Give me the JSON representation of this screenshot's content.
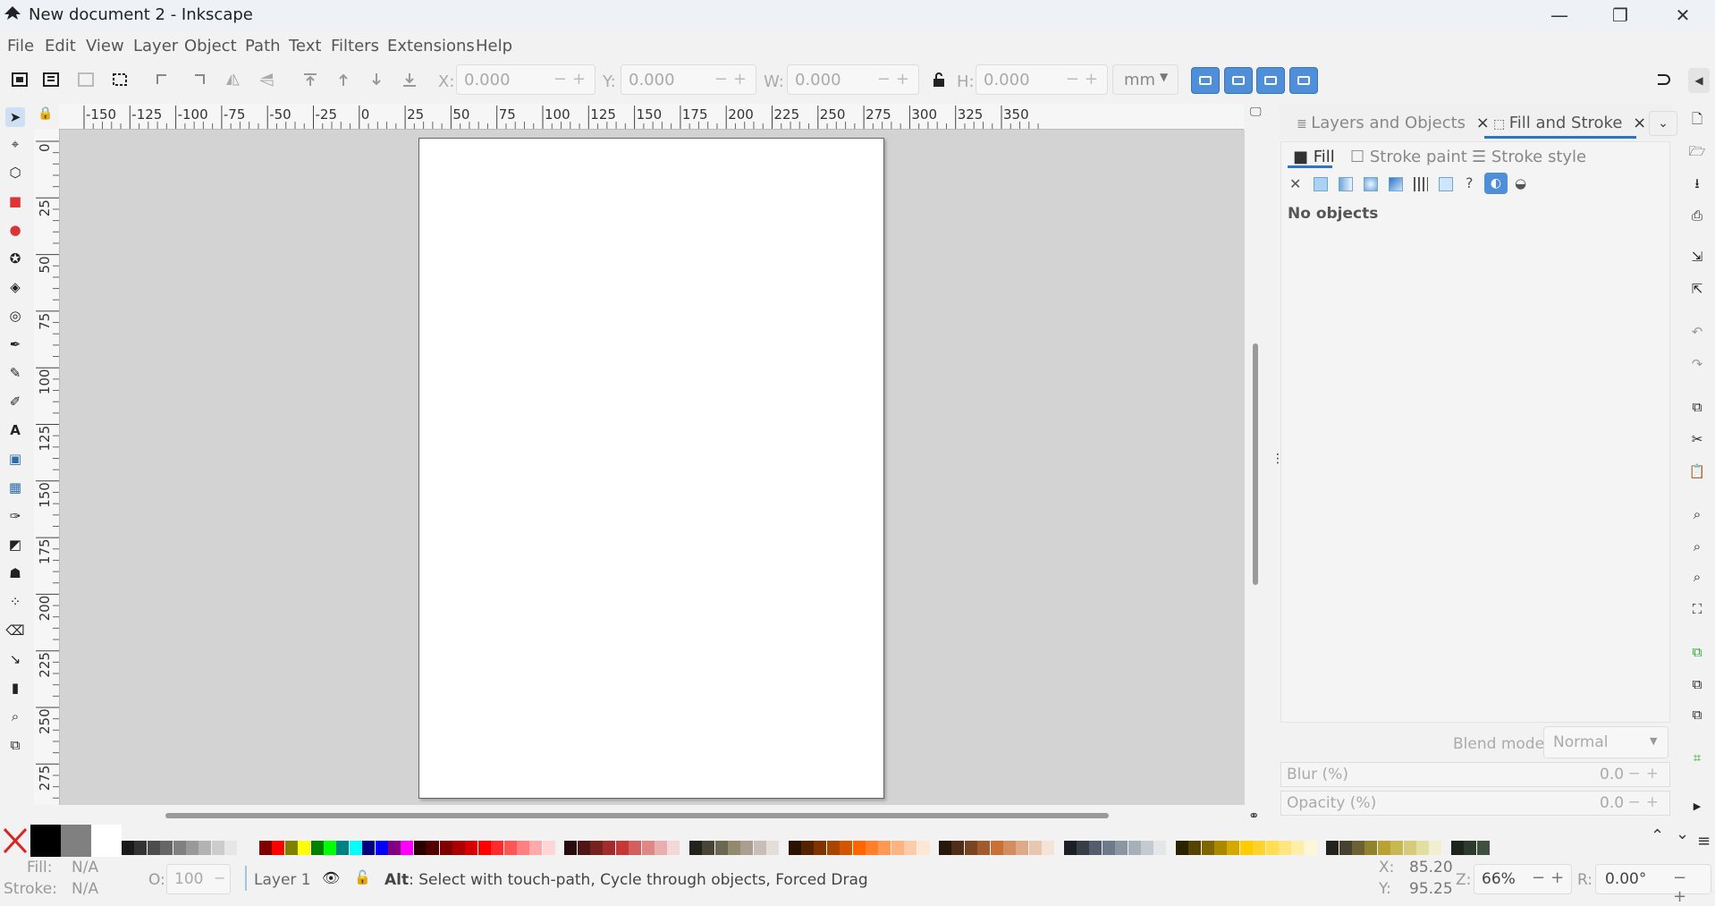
{
  "window": {
    "title": "New document 2 - Inkscape"
  },
  "menu": [
    "File",
    "Edit",
    "View",
    "Layer",
    "Object",
    "Path",
    "Text",
    "Filters",
    "Extensions",
    "Help"
  ],
  "toolbar": {
    "x_label": "X:",
    "x_value": "0.000",
    "y_label": "Y:",
    "y_value": "0.000",
    "w_label": "W:",
    "w_value": "0.000",
    "h_label": "H:",
    "h_value": "0.000",
    "unit": "mm"
  },
  "ruler": {
    "h_labels": [
      "-150",
      "-125",
      "-100",
      "-75",
      "-50",
      "-25",
      "0",
      "25",
      "50",
      "75",
      "100",
      "125",
      "150",
      "175",
      "200",
      "225",
      "250",
      "275",
      "300",
      "325",
      "350"
    ],
    "v_labels": [
      "0",
      "25",
      "50",
      "75",
      "100",
      "125",
      "150",
      "175",
      "200",
      "225",
      "250",
      "275"
    ]
  },
  "dock": {
    "tabs": [
      {
        "label": "Layers and Objects",
        "icon": "layers-icon"
      },
      {
        "label": "Fill and Stroke",
        "icon": "fill-stroke-icon"
      }
    ],
    "subtabs": [
      "Fill",
      "Stroke paint",
      "Stroke style"
    ],
    "no_objects": "No objects",
    "blend_label": "Blend mode:",
    "blend_value": "Normal",
    "blur_label": "Blur (%)",
    "blur_value": "0.0",
    "opacity_label": "Opacity (%)",
    "opacity_value": "0.0"
  },
  "status": {
    "fill_label": "Fill:",
    "fill_value": "N/A",
    "stroke_label": "Stroke:",
    "stroke_value": "N/A",
    "o_label": "O:",
    "o_value": "100",
    "layer": "Layer 1",
    "hint_key": "Alt",
    "hint_text": ": Select with touch-path, Cycle through objects, Forced Drag",
    "x_label": "X:",
    "x_value": "85.20",
    "y_label": "Y:",
    "y_value": "95.25",
    "z_label": "Z:",
    "zoom": "66%",
    "r_label": "R:",
    "rotation": "0.00°"
  },
  "colors": {
    "accent": "#4f8ed8",
    "canvas_bg": "#d3d3d3",
    "page": "#ffffff"
  }
}
